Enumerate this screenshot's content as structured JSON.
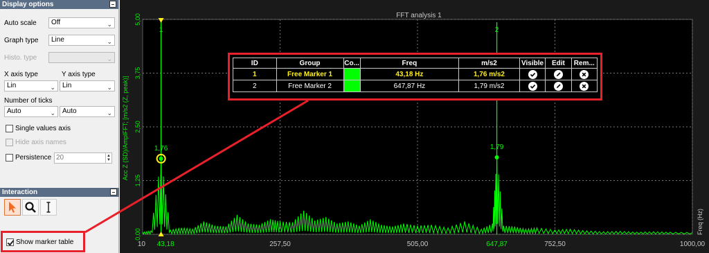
{
  "display_options": {
    "header": "Display options",
    "auto_scale": {
      "label": "Auto scale",
      "value": "Off"
    },
    "graph_type": {
      "label": "Graph type",
      "value": "Line"
    },
    "histo_type": {
      "label": "Histo. type",
      "value": ""
    },
    "x_axis_type": {
      "label": "X axis type",
      "value": "Lin"
    },
    "y_axis_type": {
      "label": "Y axis type",
      "value": "Lin"
    },
    "number_of_ticks": {
      "label": "Number of ticks",
      "x_value": "Auto",
      "y_value": "Auto"
    },
    "single_values_axis": {
      "label": "Single values axis",
      "checked": false
    },
    "hide_axis_names": {
      "label": "Hide axis names",
      "checked": false
    },
    "persistence": {
      "label": "Persistence",
      "value": "20",
      "checked": false
    }
  },
  "interaction": {
    "header": "Interaction",
    "tools": [
      "pointer-tool-icon",
      "zoom-tool-icon",
      "cursor-tool-icon"
    ],
    "show_marker_table": {
      "label": "Show marker table",
      "checked": true
    }
  },
  "chart": {
    "title": "FFT analysis 1",
    "y_axis_label": "Acc Z (SD)/AmplFFT; [m/s2 (Z, peak)]",
    "x_axis_label": "Freq (Hz)",
    "y_ticks": [
      "5,00",
      "3,75",
      "2,50",
      "1,25",
      "0,00"
    ],
    "x_ticks": [
      "10",
      "43,18",
      "257,50",
      "505,00",
      "647,87",
      "752,50",
      "1000,00"
    ],
    "marker1": {
      "id": "1",
      "value_label": "1,76"
    },
    "marker2": {
      "id": "2",
      "value_label": "1,79"
    }
  },
  "chart_data": {
    "type": "line",
    "title": "FFT analysis 1",
    "xlabel": "Freq (Hz)",
    "ylabel": "Acc Z (SD)/AmplFFT; [m/s2 (Z, peak)]",
    "xlim": [
      10,
      1000
    ],
    "ylim": [
      0,
      5
    ],
    "x_ticks": [
      257.5,
      505,
      752.5,
      1000
    ],
    "y_ticks": [
      0,
      1.25,
      2.5,
      3.75,
      5
    ],
    "series": [
      {
        "color": "#00ff00",
        "x": [
          10,
          25,
          43.18,
          60,
          80,
          100,
          120,
          140,
          160,
          180,
          200,
          220,
          240,
          257.5,
          280,
          300,
          320,
          340,
          360,
          380,
          400,
          420,
          440,
          460,
          480,
          505,
          530,
          560,
          590,
          620,
          640,
          647.87,
          660,
          680,
          700,
          720,
          752.5,
          780,
          810,
          840,
          870,
          900,
          930,
          960,
          1000
        ],
        "y": [
          0.05,
          0.08,
          1.76,
          0.1,
          0.15,
          0.12,
          0.3,
          0.2,
          0.18,
          0.45,
          0.25,
          0.22,
          0.35,
          0.3,
          0.28,
          0.55,
          0.32,
          0.4,
          0.25,
          0.3,
          0.2,
          0.35,
          0.22,
          0.18,
          0.25,
          0.2,
          0.22,
          0.15,
          0.3,
          0.12,
          0.25,
          1.79,
          0.2,
          0.18,
          0.12,
          0.15,
          0.1,
          0.12,
          0.08,
          0.06,
          0.07,
          0.05,
          0.06,
          0.05,
          0.04
        ]
      }
    ],
    "markers": [
      {
        "id": "1",
        "x": 43.18,
        "y": 1.76
      },
      {
        "id": "2",
        "x": 647.87,
        "y": 1.79
      }
    ],
    "grid": true
  },
  "marker_table": {
    "headers": [
      "ID",
      "Group",
      "Co...",
      "Freq",
      "m/s2",
      "Visible",
      "Edit",
      "Rem..."
    ],
    "rows": [
      {
        "id": "1",
        "group": "Free Marker 1",
        "color": "#00ff00",
        "freq": "43,18 Hz",
        "value": "1,76 m/s2"
      },
      {
        "id": "2",
        "group": "Free Marker 2",
        "color": "#00ff00",
        "freq": "647,87 Hz",
        "value": "1,79 m/s2"
      }
    ]
  },
  "colors": {
    "accent": "#e8202a",
    "trace": "#00ff00",
    "marker_highlight": "#ffef1a"
  }
}
